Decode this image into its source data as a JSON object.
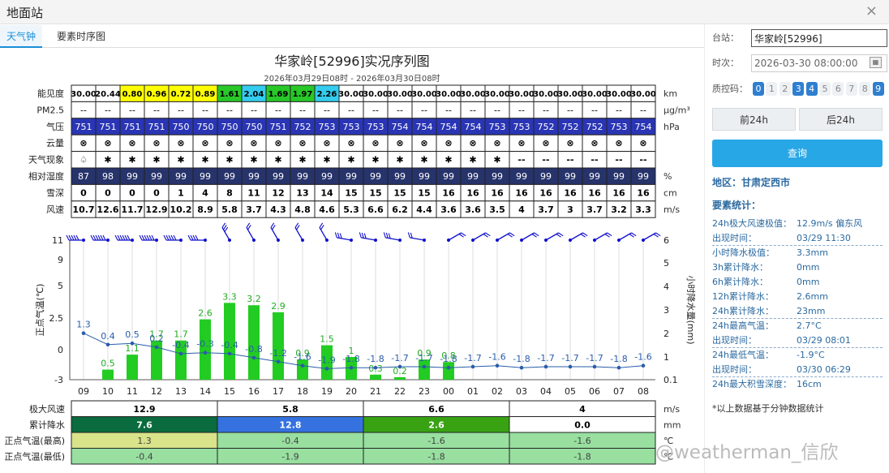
{
  "window": {
    "title": "地面站",
    "close_glyph": "×"
  },
  "tabs": [
    {
      "label": "天气钟",
      "active": true
    },
    {
      "label": "要素时序图",
      "active": false
    }
  ],
  "chart_title": "华家岭[52996]实况序列图",
  "chart_subtitle": "2026年03月29日08时 - 2026年03月30日08时",
  "row_labels": [
    "能见度",
    "PM2.5",
    "气压",
    "云量",
    "天气现象",
    "相对湿度",
    "雪深",
    "风速"
  ],
  "row_units": [
    "km",
    "μg/m³",
    "hPa",
    "",
    "",
    "%",
    "cm",
    "m/s"
  ],
  "visibility": [
    "30.00",
    "20.44",
    "0.80",
    "0.96",
    "0.72",
    "0.89",
    "1.61",
    "2.04",
    "1.69",
    "1.97",
    "2.26",
    "30.00",
    "30.00",
    "30.00",
    "30.00",
    "30.00",
    "30.00",
    "30.00",
    "30.00",
    "30.00",
    "30.00",
    "30.00",
    "30.00",
    "30.00"
  ],
  "pm25": [
    "--",
    "--",
    "--",
    "--",
    "--",
    "--",
    "--",
    "--",
    "--",
    "--",
    "--",
    "--",
    "--",
    "--",
    "--",
    "--",
    "--",
    "--",
    "--",
    "--",
    "--",
    "--",
    "--",
    "--"
  ],
  "pressure": [
    "751",
    "751",
    "751",
    "751",
    "750",
    "750",
    "750",
    "750",
    "751",
    "752",
    "753",
    "753",
    "753",
    "754",
    "754",
    "754",
    "754",
    "753",
    "753",
    "752",
    "752",
    "752",
    "753",
    "754"
  ],
  "cloud": [
    "⊗",
    "⊗",
    "⊗",
    "⊗",
    "⊗",
    "⊗",
    "⊗",
    "⊗",
    "⊗",
    "⊗",
    "⊗",
    "⊗",
    "⊗",
    "⊗",
    "⊗",
    "⊗",
    "⊗",
    "⊗",
    "⊗",
    "⊗",
    "⊗",
    "⊗",
    "⊗",
    "⊗"
  ],
  "weather": [
    "♤",
    "✱",
    "✱",
    "✱",
    "✱",
    "✱",
    "✱",
    "✱",
    "✱",
    "✱",
    "✱",
    "✱",
    "✱",
    "✱",
    "✱",
    "✱",
    "✱",
    "✱",
    "--",
    "--",
    "--",
    "--",
    "--",
    "--"
  ],
  "humidity": [
    "87",
    "98",
    "99",
    "99",
    "99",
    "99",
    "99",
    "99",
    "99",
    "99",
    "99",
    "99",
    "99",
    "99",
    "99",
    "99",
    "99",
    "99",
    "99",
    "99",
    "99",
    "99",
    "99",
    "99"
  ],
  "snow_depth": [
    "0",
    "0",
    "0",
    "0",
    "1",
    "4",
    "8",
    "11",
    "12",
    "13",
    "14",
    "15",
    "15",
    "15",
    "15",
    "16",
    "16",
    "16",
    "16",
    "16",
    "16",
    "16",
    "16",
    "16"
  ],
  "wind_speed": [
    "10.7",
    "12.6",
    "11.7",
    "12.9",
    "10.2",
    "8.9",
    "5.8",
    "3.7",
    "4.3",
    "4.8",
    "4.6",
    "5.3",
    "6.6",
    "6.2",
    "4.4",
    "3.6",
    "3.6",
    "3.5",
    "4",
    "3.7",
    "3",
    "3.7",
    "3.2",
    "3.3"
  ],
  "colors": {
    "vis_low": "#ffff00",
    "vis_mid": "#28c828",
    "vis_cyan": "#33ccee",
    "pressure": "#2a35b5",
    "humidity": "#27336b",
    "bar": "#22cc22",
    "temp_line": "#2a5caa",
    "wind_barb": "#1111cc",
    "gust_green": "#0a6b3e",
    "precip_blue": "#3572e0",
    "precip_green": "#38a212",
    "temp_max": "#d8e38a",
    "temp_min": "#98dfa0"
  },
  "chart_data": {
    "type": "bar",
    "x": [
      "09",
      "10",
      "11",
      "12",
      "13",
      "14",
      "15",
      "16",
      "17",
      "18",
      "19",
      "20",
      "21",
      "22",
      "23",
      "00",
      "01",
      "02",
      "03",
      "04",
      "05",
      "06",
      "07",
      "08"
    ],
    "series": [
      {
        "values": [
          null,
          0.5,
          1.1,
          1.7,
          1.7,
          2.6,
          3.3,
          3.2,
          2.9,
          0.9,
          1.5,
          1,
          0.3,
          0.2,
          0.9,
          0.8,
          null,
          null,
          null,
          null,
          null,
          null,
          null,
          null
        ]
      },
      {
        "values": [
          1.3,
          0.4,
          0.5,
          0.2,
          -0.4,
          -0.3,
          -0.4,
          -0.8,
          -1.2,
          -1.6,
          -1.9,
          -1.8,
          -1.8,
          -1.7,
          -1.7,
          -1.8,
          -1.7,
          -1.6,
          -1.8,
          -1.7,
          -1.7,
          -1.7,
          -1.8,
          -1.6
        ]
      }
    ],
    "y_left": {
      "label": "正点气温(℃)",
      "ticks": [
        11,
        9,
        5,
        2.5,
        0,
        -3
      ]
    },
    "y_right": {
      "label": "小时降水量(mm)",
      "ticks": [
        6,
        5,
        4,
        3,
        2,
        1,
        0.1
      ]
    },
    "wind_barb_speeds": [
      10.7,
      12.6,
      11.7,
      12.9,
      10.2,
      8.9,
      5.8,
      3.7,
      4.3,
      4.8,
      4.6,
      5.3,
      6.6,
      6.2,
      4.4,
      3.6,
      3.6,
      3.5,
      4,
      3.7,
      3,
      3.7,
      3.2,
      3.3
    ]
  },
  "summary_labels": [
    "极大风速",
    "累计降水",
    "正点气温(最高)",
    "正点气温(最低)"
  ],
  "summary_units": [
    "m/s",
    "mm",
    "℃",
    "℃"
  ],
  "summary": [
    [
      "12.9",
      "5.8",
      "6.6",
      "4"
    ],
    [
      "7.6",
      "12.8",
      "2.6",
      "0.0"
    ],
    [
      "1.3",
      "-0.4",
      "-1.6",
      "-1.6"
    ],
    [
      "-0.4",
      "-1.9",
      "-1.8",
      "-1.8"
    ]
  ],
  "side": {
    "station_label": "台站：",
    "station_value": "华家岭[52996]",
    "time_label": "时次：",
    "time_value": "2026-03-30 08:00:00",
    "qc_label": "质控码：",
    "qc_codes": [
      {
        "c": "0",
        "on": true
      },
      {
        "c": "1",
        "on": false
      },
      {
        "c": "2",
        "on": false
      },
      {
        "c": "3",
        "on": true
      },
      {
        "c": "4",
        "on": true
      },
      {
        "c": "5",
        "on": false
      },
      {
        "c": "6",
        "on": false
      },
      {
        "c": "7",
        "on": false
      },
      {
        "c": "8",
        "on": false
      },
      {
        "c": "9",
        "on": true
      }
    ],
    "prev_label": "前24h",
    "next_label": "后24h",
    "query_label": "查询",
    "region": "地区：甘肃定西市",
    "stats_head": "要素统计：",
    "stats": [
      [
        "24h极大风速极值：",
        "12.9m/s 偏东风"
      ],
      [
        "出现时间：",
        "03/29 11:30"
      ],
      [
        "小时降水极值：",
        "3.3mm"
      ],
      [
        "3h累计降水：",
        "0mm"
      ],
      [
        "6h累计降水：",
        "0mm"
      ],
      [
        "12h累计降水：",
        "2.6mm"
      ],
      [
        "24h累计降水：",
        "23mm"
      ],
      [
        "24h最高气温：",
        "2.7°C"
      ],
      [
        "出现时间：",
        "03/29 08:01"
      ],
      [
        "24h最低气温：",
        "-1.9°C"
      ],
      [
        "出现时间：",
        "03/30 06:29"
      ],
      [
        "24h最大积雪深度：",
        "16cm"
      ]
    ],
    "note": "*以上数据基于分钟数据统计"
  },
  "watermark": "@weatherman_信欣"
}
